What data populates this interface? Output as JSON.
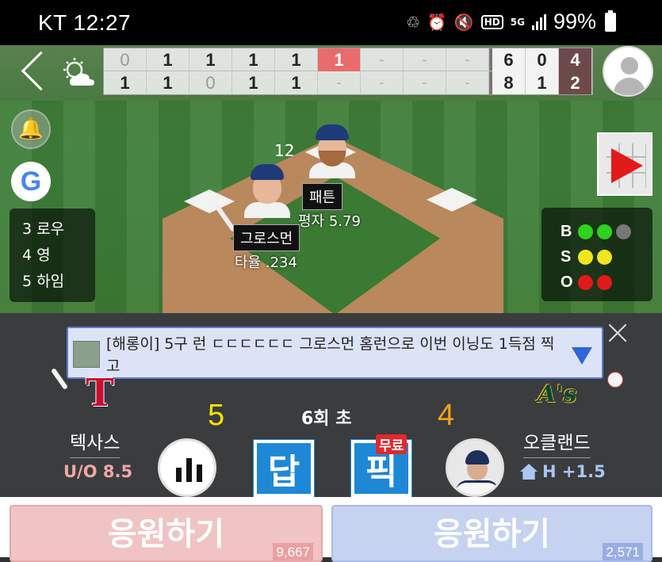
{
  "status_bar": {
    "carrier_time": "KT 12:27",
    "battery": "99%",
    "hd_label": "HD",
    "network": "5G"
  },
  "scoreboard": {
    "away_innings": [
      "0",
      "1",
      "1",
      "1",
      "1",
      "1",
      "-",
      "-",
      "-"
    ],
    "home_innings": [
      "1",
      "1",
      "0",
      "1",
      "1",
      "-",
      "-",
      "-",
      "-"
    ],
    "away_rhe": [
      "6",
      "0",
      "4"
    ],
    "home_rhe": [
      "8",
      "1",
      "2"
    ]
  },
  "lineup": [
    "3 로우",
    "4 영",
    "5 하임"
  ],
  "count": {
    "balls": 2,
    "strikes": 2,
    "outs": 2,
    "labels": [
      "B",
      "S",
      "O"
    ]
  },
  "pitcher": {
    "name": "패튼",
    "stat": "평자 5.79",
    "pitch_count": "12"
  },
  "batter": {
    "name": "그로스먼",
    "stat": "타율 .234"
  },
  "chat": {
    "message": "[해롱이] 5구 런 ㄷㄷㄷㄷㄷㄷ  그로스먼 홈런으로 이번 이닝도 1득점 찍고"
  },
  "game": {
    "inning": "6회 초",
    "away": {
      "name": "텍사스",
      "score": "5",
      "line": "U/O 8.5"
    },
    "home": {
      "name": "오클랜드",
      "score": "4",
      "line": "H +1.5"
    }
  },
  "buttons": {
    "answer": "답",
    "pick": "픽",
    "free_badge": "무료"
  },
  "cheer": {
    "away": {
      "label": "응원하기",
      "count": "9,667"
    },
    "home": {
      "label": "응원하기",
      "count": "2,571"
    }
  },
  "colors": {
    "away_score": "#ffe000",
    "home_score": "#f5a21a",
    "current_inning": "#e96b6b"
  }
}
